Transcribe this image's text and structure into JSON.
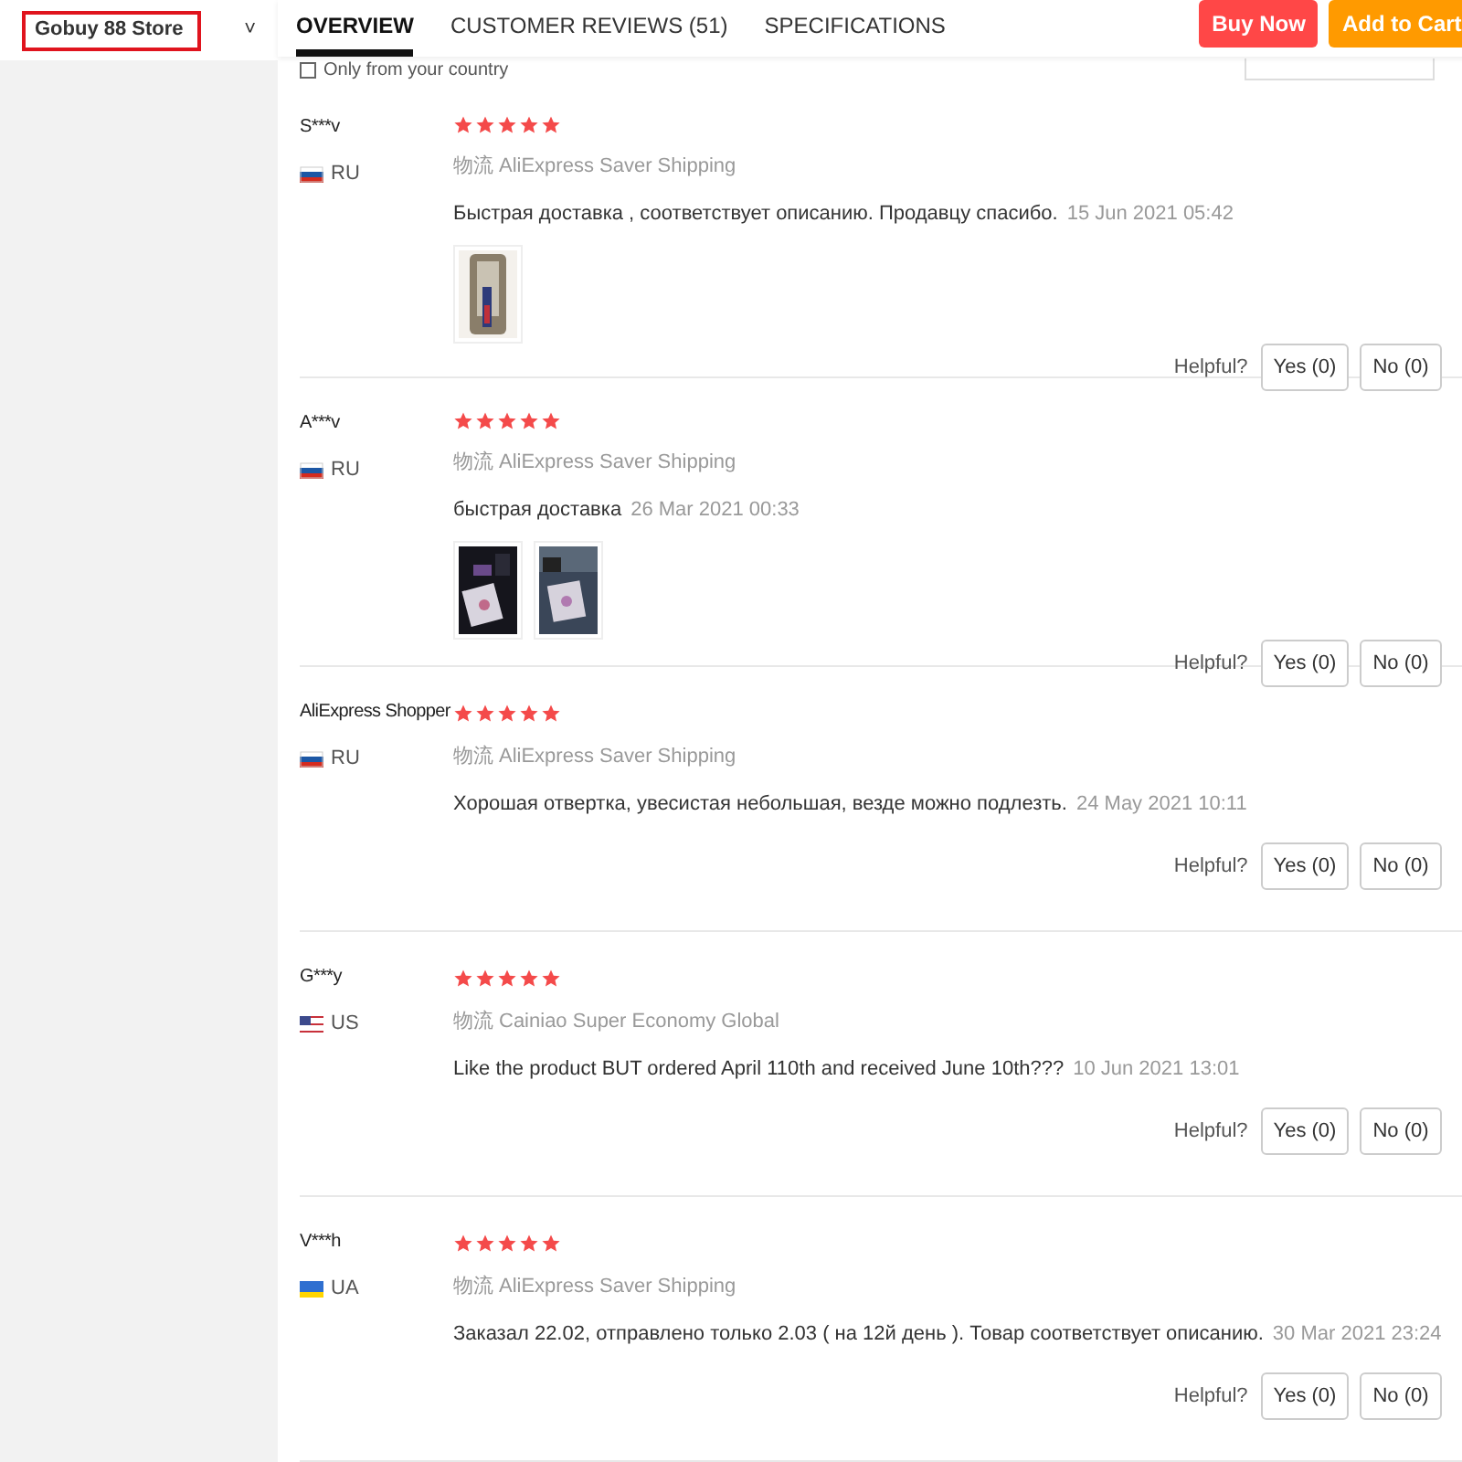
{
  "store_selector": {
    "label": "Gobuy 88 Store",
    "caret": "˅"
  },
  "tabs": [
    {
      "label": "OVERVIEW",
      "selected": true
    },
    {
      "label": "CUSTOMER REVIEWS (51)",
      "selected": false
    },
    {
      "label": "SPECIFICATIONS",
      "selected": false
    }
  ],
  "actions": [
    {
      "label": "Buy Now",
      "kind": "buy"
    },
    {
      "label": "Add to Cart",
      "kind": "cart"
    }
  ],
  "filter": {
    "label": "Only from your country",
    "checked": false
  },
  "reviews": [
    {
      "name": "S***v",
      "flag": {
        "kind": "ru"
      },
      "country": "RU",
      "stars": 5,
      "logistics": "物流",
      "shipping": "AliExpress Saver Shipping",
      "text": "Быстрая доставка , соответствует описанию. Продавцу спасибо.",
      "date": "15 Jun 2021 05:42",
      "photos": [
        {
          "kind": "picture"
        }
      ],
      "helpful": "Helpful?",
      "yes": "Yes (0)",
      "no": "No (0)"
    },
    {
      "name": "A***v",
      "flag": {
        "kind": "ru"
      },
      "country": "RU",
      "stars": 5,
      "logistics": "物流",
      "shipping": "AliExpress Saver Shipping",
      "text": "быстрая доставка",
      "date": "26 Mar 2021 00:33",
      "photos": [
        {
          "kind": "picture"
        },
        {
          "kind": "picture"
        }
      ],
      "helpful": "Helpful?",
      "yes": "Yes (0)",
      "no": "No (0)"
    },
    {
      "name": "AliExpress Shopper",
      "flag": {
        "kind": "ru"
      },
      "country": "RU",
      "stars": 5,
      "logistics": "物流",
      "shipping": "AliExpress Saver Shipping",
      "text": "Хорошая отвертка, увесистая небольшая, везде можно подлезть.",
      "date": "24 May 2021 10:11",
      "helpful": "Helpful?",
      "yes": "Yes (0)",
      "no": "No (0)"
    },
    {
      "name": "G***y",
      "flag": {
        "kind": "us"
      },
      "country": "US",
      "stars": 5,
      "logistics": "物流",
      "shipping": "Cainiao Super Economy Global",
      "text": "Like the product BUT ordered April 110th and received June 10th???",
      "date": "10 Jun 2021 13:01",
      "helpful": "Helpful?",
      "yes": "Yes (0)",
      "no": "No (0)"
    },
    {
      "name": "V***h",
      "flag": {
        "kind": "ua"
      },
      "country": "UA",
      "stars": 5,
      "logistics": "物流",
      "shipping": "AliExpress Saver Shipping",
      "text": "Заказал 22.02, отправлено только 2.03 ( на 12й день ). Товар соответствует описанию.",
      "date": "30 Mar 2021 23:24",
      "helpful": "Helpful?",
      "yes": "Yes (0)",
      "no": "No (0)"
    }
  ]
}
